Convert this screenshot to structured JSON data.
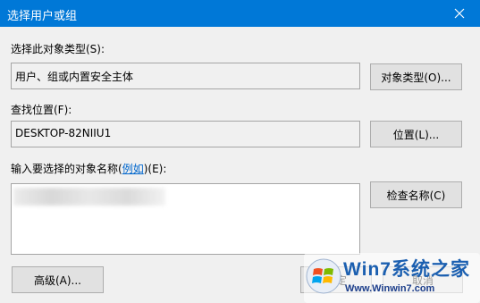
{
  "window": {
    "title": "选择用户或组",
    "close_icon": "close-icon"
  },
  "object_type": {
    "label": "选择此对象类型(S):",
    "value": "用户、组或内置安全主体",
    "button": "对象类型(O)..."
  },
  "location": {
    "label": "查找位置(F):",
    "value": "DESKTOP-82NIIU1",
    "button": "位置(L)..."
  },
  "names": {
    "label_prefix": "输入要选择的对象名称(",
    "example_link": "例如",
    "label_suffix": ")(E):",
    "check_button": "检查名称(C)"
  },
  "footer": {
    "advanced_button": "高级(A)...",
    "ok_button": "确定",
    "cancel_button": "取消"
  },
  "watermark": {
    "title": "Win7系统之家",
    "url": "Www.Winwin7.com"
  },
  "colors": {
    "titlebar": "#0078d7",
    "link": "#0066cc"
  }
}
